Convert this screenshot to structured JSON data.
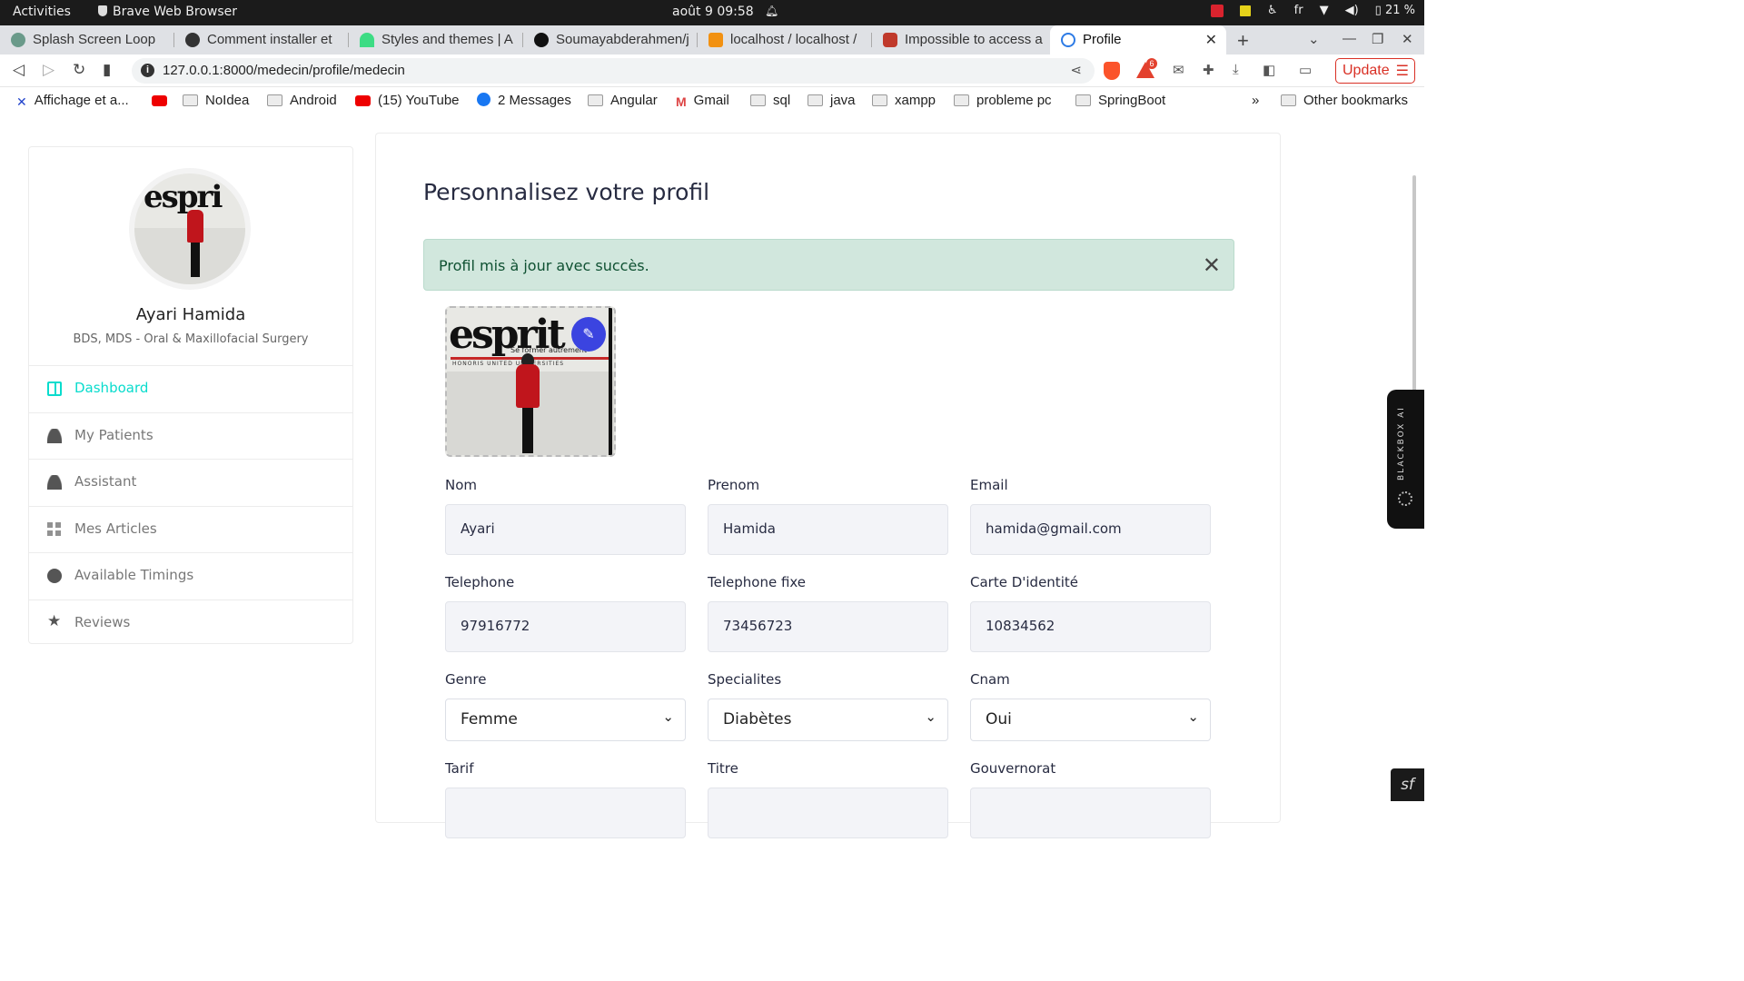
{
  "os_bar": {
    "activities": "Activities",
    "app_name": "Brave Web Browser",
    "clock": "août 9  09:58",
    "lang": "fr",
    "battery": "21 %"
  },
  "tabs": [
    {
      "title": "Splash Screen Loop",
      "favicon_color": "#6a9a8a"
    },
    {
      "title": "Comment installer et",
      "favicon_color": "#333333"
    },
    {
      "title": "Styles and themes  |  A",
      "favicon_color": "#3ddc84"
    },
    {
      "title": "Soumayabderahmen/j",
      "favicon_color": "#111111"
    },
    {
      "title": "localhost / localhost /",
      "favicon_color": "#f29111"
    },
    {
      "title": "Impossible to access a",
      "favicon_color": "#c0392b"
    },
    {
      "title": "Profile",
      "favicon_color": "#2d7be5"
    }
  ],
  "address_bar": {
    "url": "127.0.0.1:8000/medecin/profile/medecin",
    "update_label": "Update",
    "rewards_badge": "6"
  },
  "bookmarks": [
    {
      "label": "Affichage et a...",
      "icon": "x-icon"
    },
    {
      "label": "",
      "icon": "youtube-icon"
    },
    {
      "label": "NoIdea",
      "icon": "folder-icon"
    },
    {
      "label": "Android",
      "icon": "folder-icon"
    },
    {
      "label": "(15) YouTube",
      "icon": "youtube-icon"
    },
    {
      "label": "2 Messages",
      "icon": "facebook-icon"
    },
    {
      "label": "Angular",
      "icon": "folder-icon"
    },
    {
      "label": "Gmail",
      "icon": "gmail-icon"
    },
    {
      "label": "sql",
      "icon": "folder-icon"
    },
    {
      "label": "java",
      "icon": "folder-icon"
    },
    {
      "label": "xampp",
      "icon": "folder-icon"
    },
    {
      "label": "probleme pc",
      "icon": "folder-icon"
    },
    {
      "label": "SpringBoot",
      "icon": "folder-icon"
    }
  ],
  "bookmarks_overflow": "»",
  "other_bookmarks": "Other bookmarks",
  "profile_card": {
    "avatar_sign": "espri",
    "name": "Ayari Hamida",
    "specialty": "BDS, MDS - Oral & Maxillofacial Surgery"
  },
  "side_menu": [
    {
      "label": "Dashboard",
      "icon": "dashboard-icon",
      "active": true
    },
    {
      "label": "My Patients",
      "icon": "patients-icon",
      "active": false
    },
    {
      "label": "Assistant",
      "icon": "assistant-icon",
      "active": false
    },
    {
      "label": "Mes Articles",
      "icon": "grid-icon",
      "active": false
    },
    {
      "label": "Available Timings",
      "icon": "clock-icon",
      "active": false
    },
    {
      "label": "Reviews",
      "icon": "star-icon",
      "active": false
    }
  ],
  "main": {
    "title": "Personnalisez votre profil",
    "alert": "Profil mis à jour avec succès.",
    "photo_sign": "esprit",
    "photo_sub": "Se former autrement",
    "photo_banner": "HONORIS UNITED UNIVERSITIES",
    "fields": {
      "nom": {
        "label": "Nom",
        "value": "Ayari"
      },
      "prenom": {
        "label": "Prenom",
        "value": "Hamida"
      },
      "email": {
        "label": "Email",
        "value": "hamida@gmail.com"
      },
      "telephone": {
        "label": "Telephone",
        "value": "97916772"
      },
      "telephone_fixe": {
        "label": "Telephone fixe",
        "value": "73456723"
      },
      "carte": {
        "label": "Carte D'identité",
        "value": "10834562"
      },
      "genre": {
        "label": "Genre",
        "value": "Femme"
      },
      "specialites": {
        "label": "Specialites",
        "value": "Diabètes"
      },
      "cnam": {
        "label": "Cnam",
        "value": "Oui"
      },
      "tarif": {
        "label": "Tarif",
        "value": ""
      },
      "titre": {
        "label": "Titre",
        "value": ""
      },
      "gouvernorat": {
        "label": "Gouvernorat",
        "value": ""
      }
    }
  },
  "blackbox": {
    "label": "BLACKBOX AI"
  },
  "colors": {
    "accent": "#09dccd",
    "alert_bg": "#d1e7dd",
    "alert_text": "#0f5132",
    "edit_button": "#3b44e0",
    "update_red": "#d93025"
  }
}
